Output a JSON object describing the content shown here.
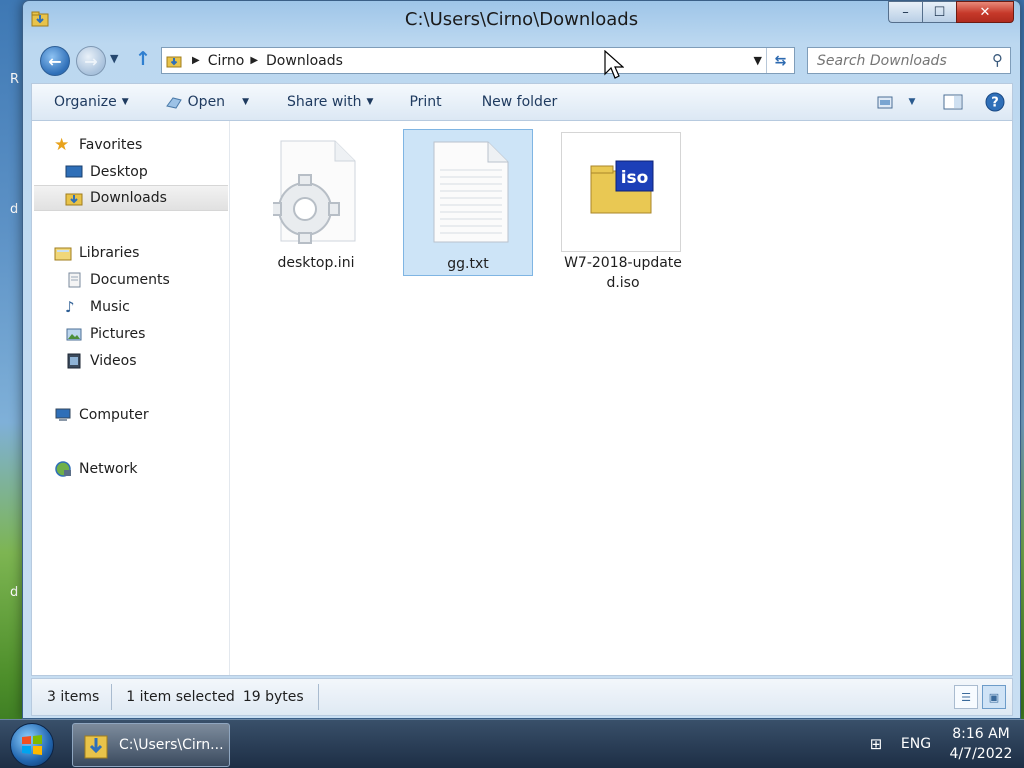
{
  "desktop": {
    "letters": [
      "R",
      "d",
      "d"
    ]
  },
  "window": {
    "title": "C:\\Users\\Cirno\\Downloads",
    "caption": {
      "minimize": "–",
      "maximize": "☐",
      "close": "✕"
    }
  },
  "nav": {
    "back": "←",
    "forward": "→",
    "up": "↑"
  },
  "address": {
    "crumbs": [
      "Cirno",
      "Downloads"
    ]
  },
  "search": {
    "placeholder": "Search Downloads"
  },
  "toolbar": {
    "organize": "Organize",
    "open": "Open",
    "share_with": "Share with",
    "print": "Print",
    "new_folder": "New folder"
  },
  "sidebar": {
    "favorites": "Favorites",
    "desktop": "Desktop",
    "downloads": "Downloads",
    "libraries": "Libraries",
    "documents": "Documents",
    "music": "Music",
    "pictures": "Pictures",
    "videos": "Videos",
    "computer": "Computer",
    "network": "Network"
  },
  "files": [
    {
      "name": "desktop.ini",
      "icon": "settings-file-icon",
      "selected": false
    },
    {
      "name": "gg.txt",
      "icon": "text-file-icon",
      "selected": true
    },
    {
      "name_line1": "W7-2018-update",
      "name_line2": "d.iso",
      "icon": "iso-file-icon",
      "selected": false
    }
  ],
  "status": {
    "items": "3 items",
    "selected": "1 item selected",
    "size": "19 bytes"
  },
  "taskbar": {
    "task_label": "C:\\Users\\Cirn...",
    "language": "ENG",
    "time": "8:16 AM",
    "date": "4/7/2022"
  },
  "colors": {
    "selection": "#cde4f7",
    "close_button": "#c6392a",
    "accent": "#2f6fb8"
  }
}
